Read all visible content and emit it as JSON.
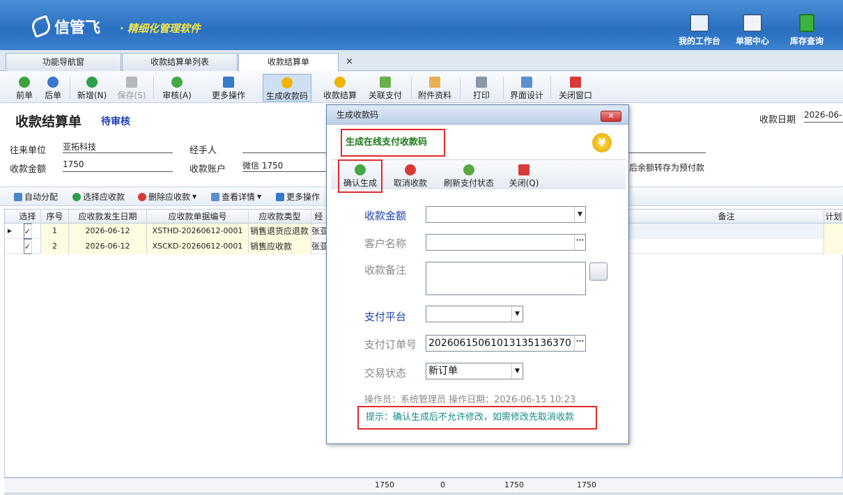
{
  "app": {
    "logo": "信管飞",
    "slogan": "· 精细化管理软件",
    "top_buttons": [
      "我的工作台",
      "单据中心",
      "库存查询"
    ]
  },
  "tabs": [
    "功能导航窗",
    "收款结算单列表",
    "收款结算单"
  ],
  "toolbar": [
    "前单",
    "后单",
    "新增(N)",
    "保存(S)",
    "审核(A)",
    "更多操作",
    "生成收款码",
    "收款结算",
    "关联支付",
    "附件资料",
    "打印",
    "界面设计",
    "关闭窗口"
  ],
  "form": {
    "title": "收款结算单",
    "status": "待审核",
    "date_label": "收款日期",
    "date_value": "2026-06-",
    "partner_label": "往来单位",
    "partner_value": "亚拓科技",
    "handler_label": "经手人",
    "amount_label": "收款金额",
    "amount_value": "1750",
    "account_label": "收款账户",
    "account_value": "微信 1750",
    "note_right": "后余额转存为预付款"
  },
  "sub_toolbar": [
    "自动分配",
    "选择应收款",
    "删除应收款",
    "查看详情",
    "更多操作"
  ],
  "grid": {
    "headers": [
      "选择",
      "序号",
      "应收款发生日期",
      "应收款单据编号",
      "应收款类型",
      "经",
      "备注",
      "计划"
    ],
    "rows": [
      {
        "seq": "1",
        "date": "2026-06-12",
        "no": "XSTHD-20260612-0001",
        "type": "销售退货应退款",
        "person": "张亚"
      },
      {
        "seq": "2",
        "date": "2026-06-12",
        "no": "XSCKD-20260612-0001",
        "type": "销售应收款",
        "person": "张亚"
      }
    ],
    "footer": [
      "1750",
      "0",
      "1750",
      "1750"
    ]
  },
  "dialog": {
    "title": "生成收款码",
    "close": "✕",
    "heading": "生成在线支付收款码",
    "toolbar": [
      "确认生成",
      "取消收款",
      "刷新支付状态",
      "关闭(Q)"
    ],
    "fields": {
      "amount": "收款金额",
      "customer": "客户名称",
      "remark": "收款备注",
      "platform": "支付平台",
      "order_no": "支付订单号",
      "order_no_value": "20260615061013135136370",
      "trade_status": "交易状态",
      "trade_status_value": "新订单"
    },
    "op_info": "操作员：系统管理员  操作日期：2026-06-15 10:23",
    "tip": "提示：确认生成后不允许修改，如需修改先取消收款"
  }
}
